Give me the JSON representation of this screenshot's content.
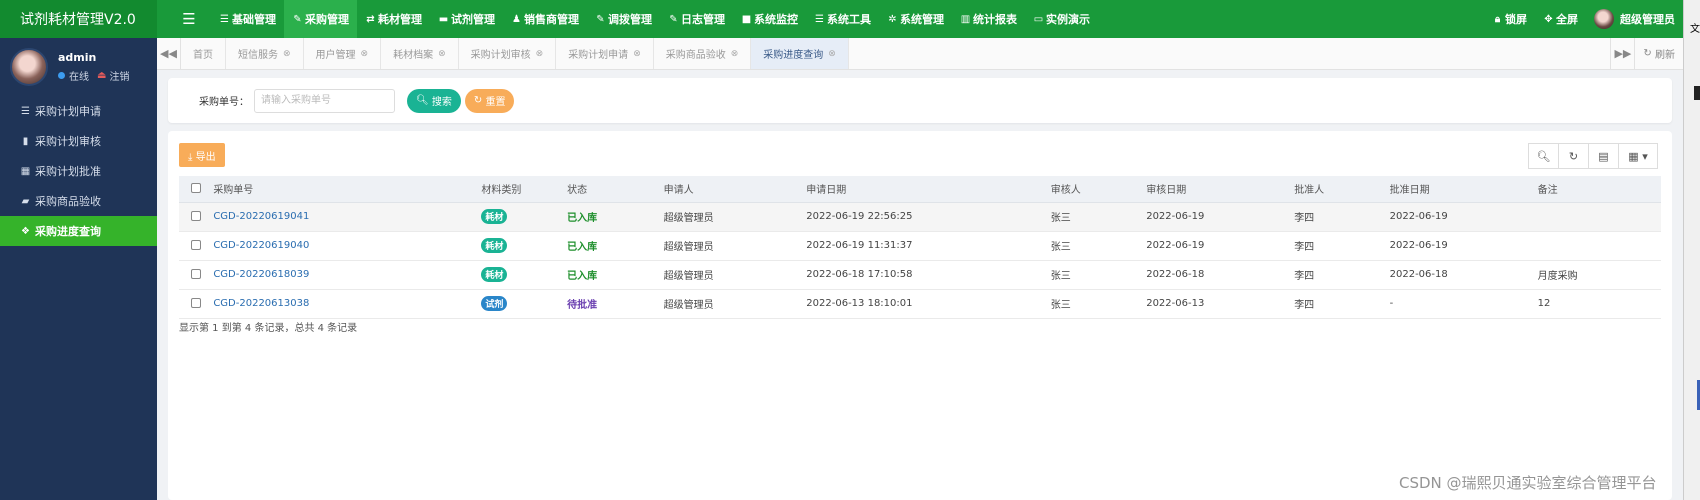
{
  "app": {
    "title": "试剂耗材管理V2.0"
  },
  "topnav": [
    {
      "label": "基础管理",
      "icon": "list-icon"
    },
    {
      "label": "采购管理",
      "icon": "edit-icon",
      "active": true
    },
    {
      "label": "耗材管理",
      "icon": "exchange-icon"
    },
    {
      "label": "试剂管理",
      "icon": "folder-icon"
    },
    {
      "label": "销售商管理",
      "icon": "user-plus-icon"
    },
    {
      "label": "调拨管理",
      "icon": "edit-icon"
    },
    {
      "label": "日志管理",
      "icon": "edit-icon"
    },
    {
      "label": "系统监控",
      "icon": "video-icon"
    },
    {
      "label": "系统工具",
      "icon": "list-icon"
    },
    {
      "label": "系统管理",
      "icon": "gear-icon"
    },
    {
      "label": "统计报表",
      "icon": "chart-icon"
    },
    {
      "label": "实例演示",
      "icon": "monitor-icon"
    }
  ],
  "topright": {
    "lock": "锁屏",
    "fullscreen": "全屏",
    "username": "超级管理员"
  },
  "user": {
    "name": "admin",
    "status": "在线",
    "logout": "注销"
  },
  "sidebar": [
    {
      "label": "采购计划申请",
      "icon": "list-icon"
    },
    {
      "label": "采购计划审核",
      "icon": "book-icon"
    },
    {
      "label": "采购计划批准",
      "icon": "calendar-icon"
    },
    {
      "label": "采购商品验收",
      "icon": "folder-open-icon"
    },
    {
      "label": "采购进度查询",
      "icon": "cubes-icon",
      "active": true
    }
  ],
  "tabs": [
    {
      "label": "首页",
      "closable": false
    },
    {
      "label": "短信服务",
      "closable": true
    },
    {
      "label": "用户管理",
      "closable": true
    },
    {
      "label": "耗材档案",
      "closable": true
    },
    {
      "label": "采购计划审核",
      "closable": true
    },
    {
      "label": "采购计划申请",
      "closable": true
    },
    {
      "label": "采购商品验收",
      "closable": true
    },
    {
      "label": "采购进度查询",
      "closable": true,
      "active": true
    }
  ],
  "tabs_refresh": "刷新",
  "search": {
    "label": "采购单号：",
    "placeholder": "请输入采购单号",
    "search_btn": "搜索",
    "reset_btn": "重置"
  },
  "toolbar": {
    "export": "导出"
  },
  "table": {
    "columns": [
      "采购单号",
      "材料类别",
      "状态",
      "申请人",
      "申请日期",
      "审核人",
      "审核日期",
      "批准人",
      "批准日期",
      "备注"
    ],
    "rows": [
      {
        "order": "CGD-20220619041",
        "category": "耗材",
        "category_color": "#1ab394",
        "status": "已入库",
        "status_color": "#1e8f2c",
        "applicant": "超级管理员",
        "apply_date": "2022-06-19 22:56:25",
        "reviewer": "张三",
        "review_date": "2022-06-19",
        "approver": "李四",
        "approve_date": "2022-06-19",
        "remark": ""
      },
      {
        "order": "CGD-20220619040",
        "category": "耗材",
        "category_color": "#1ab394",
        "status": "已入库",
        "status_color": "#1e8f2c",
        "applicant": "超级管理员",
        "apply_date": "2022-06-19 11:31:37",
        "reviewer": "张三",
        "review_date": "2022-06-19",
        "approver": "李四",
        "approve_date": "2022-06-19",
        "remark": ""
      },
      {
        "order": "CGD-20220618039",
        "category": "耗材",
        "category_color": "#1ab394",
        "status": "已入库",
        "status_color": "#1e8f2c",
        "applicant": "超级管理员",
        "apply_date": "2022-06-18 17:10:58",
        "reviewer": "张三",
        "review_date": "2022-06-18",
        "approver": "李四",
        "approve_date": "2022-06-18",
        "remark": "月度采购"
      },
      {
        "order": "CGD-20220613038",
        "category": "试剂",
        "category_color": "#2a86c9",
        "status": "待批准",
        "status_color": "#6a3fb0",
        "applicant": "超级管理员",
        "apply_date": "2022-06-13 18:10:01",
        "reviewer": "张三",
        "review_date": "2022-06-13",
        "approver": "李四",
        "approve_date": "-",
        "remark": "12"
      }
    ]
  },
  "pagination": {
    "info": "显示第 1 到第 4 条记录，总共 4 条记录"
  },
  "watermark": "CSDN @瑞熙贝通实验室综合管理平台",
  "edge_text": "文"
}
